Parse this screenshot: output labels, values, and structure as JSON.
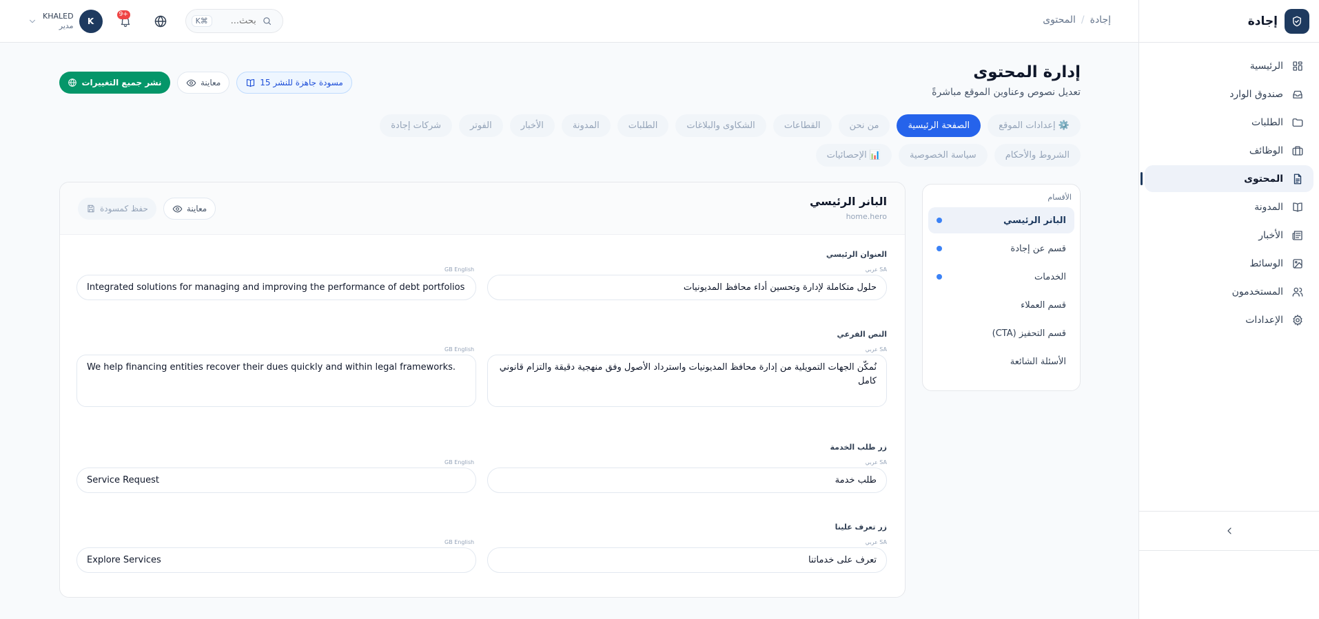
{
  "brand": {
    "name": "إجادة"
  },
  "sidebar": {
    "items": [
      {
        "label": "الرئيسية",
        "icon": "dashboard-icon"
      },
      {
        "label": "صندوق الوارد",
        "icon": "inbox-icon"
      },
      {
        "label": "الطلبات",
        "icon": "folder-icon"
      },
      {
        "label": "الوظائف",
        "icon": "briefcase-icon"
      },
      {
        "label": "المحتوى",
        "icon": "document-icon",
        "active": true
      },
      {
        "label": "المدونة",
        "icon": "book-icon"
      },
      {
        "label": "الأخبار",
        "icon": "newspaper-icon"
      },
      {
        "label": "الوسائط",
        "icon": "image-icon"
      },
      {
        "label": "المستخدمون",
        "icon": "users-icon"
      },
      {
        "label": "الإعدادات",
        "icon": "gear-icon"
      }
    ]
  },
  "topbar": {
    "breadcrumb": [
      "إجادة",
      "المحتوى"
    ],
    "search_placeholder": "بحث...",
    "search_shortcut": "K⌘",
    "notifications_badge": "9+",
    "user": {
      "name": "KHALED",
      "role": "مدير",
      "initial": "K"
    }
  },
  "page": {
    "title": "إدارة المحتوى",
    "subtitle": "تعديل نصوص وعناوين الموقع مباشرةً",
    "drafts_label": "15 مسودة جاهزة للنشر",
    "preview_label": "معاينة",
    "publish_label": "نشر جميع التغييرات"
  },
  "tabs": [
    {
      "label": "⚙️ إعدادات الموقع"
    },
    {
      "label": "الصفحة الرئيسية",
      "active": true
    },
    {
      "label": "من نحن"
    },
    {
      "label": "القطاعات"
    },
    {
      "label": "الشكاوى والبلاغات"
    },
    {
      "label": "الطلبات"
    },
    {
      "label": "المدونة"
    },
    {
      "label": "الأخبار"
    },
    {
      "label": "الفوتر"
    },
    {
      "label": "شركات إجادة"
    },
    {
      "label": "الشروط والأحكام"
    },
    {
      "label": "سياسة الخصوصية"
    },
    {
      "label": "📊 الإحصائيات"
    }
  ],
  "sections": {
    "title": "الأقسام",
    "items": [
      {
        "label": "البانر الرئيسي",
        "active": true,
        "dot": true
      },
      {
        "label": "قسم عن إجادة",
        "dot": true
      },
      {
        "label": "الخدمات",
        "dot": true
      },
      {
        "label": "قسم العملاء"
      },
      {
        "label": "قسم التحفيز (CTA)"
      },
      {
        "label": "الأسئلة الشائعة"
      }
    ]
  },
  "editor": {
    "title": "البانر الرئيسي",
    "key": "home.hero",
    "preview_label": "معاينة",
    "save_draft_label": "حفظ كمسودة",
    "lang_ar": "SA عربي",
    "lang_en": "GB English",
    "fields": [
      {
        "label": "العنوان الرئيسي",
        "ar": "حلول متكاملة لإدارة وتحسين أداء محافظ المديونيات",
        "en": "Integrated solutions for managing and improving the performance of debt portfolios",
        "multiline": false
      },
      {
        "label": "النص الفرعي",
        "ar": "نُمكّن الجهات التمويلية من إدارة محافظ المديونيات واسترداد الأصول وفق منهجية دقيقة والتزام قانوني كامل",
        "en": "We help financing entities recover their dues quickly and within legal frameworks.",
        "multiline": true
      },
      {
        "label": "زر طلب الخدمة",
        "ar": "طلب خدمة",
        "en": "Service Request",
        "multiline": false
      },
      {
        "label": "زر تعرف علينا",
        "ar": "تعرف على خدماتنا",
        "en": "Explore Services",
        "multiline": false
      }
    ]
  }
}
